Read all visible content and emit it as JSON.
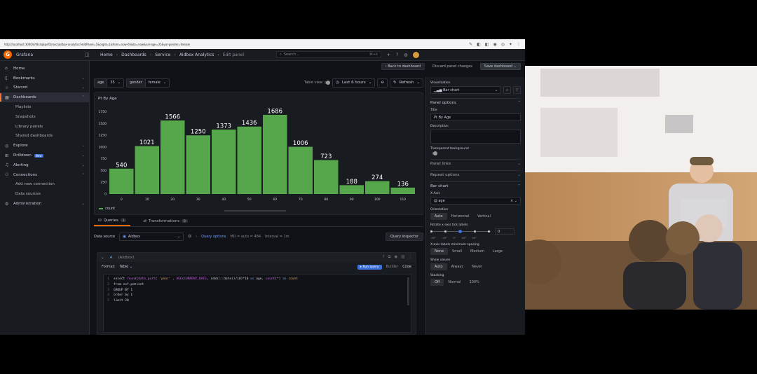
{
  "browser": {
    "url": "http://localhost:3000/d/fdx4qkqef1lmoc/aidbox-analytics?editPanel=1&orgId=1&from=now-6h&to=now&var-age=35&var-gender=female"
  },
  "app": {
    "name": "Grafana",
    "logo_letter": "G",
    "breadcrumbs": [
      "Home",
      "Dashboards",
      "Service",
      "Aidbox Analytics",
      "Edit panel"
    ],
    "search_placeholder": "Search...",
    "search_shortcut": "⌘+k",
    "plus": "+",
    "colors": {
      "brand": "#f46800",
      "bar": "#56a64b",
      "accent": "#3d71d9"
    }
  },
  "sidebar": {
    "items": [
      {
        "label": "Home",
        "icon": "home-icon"
      },
      {
        "label": "Bookmarks",
        "icon": "bookmark-icon"
      },
      {
        "label": "Starred",
        "icon": "star-icon"
      },
      {
        "label": "Dashboards",
        "icon": "dashboards-icon",
        "active": true
      },
      {
        "label": "Playlists",
        "sub": true
      },
      {
        "label": "Snapshots",
        "sub": true
      },
      {
        "label": "Library panels",
        "sub": true
      },
      {
        "label": "Shared dashboards",
        "sub": true
      },
      {
        "label": "Explore",
        "icon": "compass-icon"
      },
      {
        "label": "Drilldown",
        "icon": "drilldown-icon",
        "badge": "New"
      },
      {
        "label": "Alerting",
        "icon": "bell-icon"
      },
      {
        "label": "Connections",
        "icon": "plug-icon"
      },
      {
        "label": "Add new connection",
        "sub": true
      },
      {
        "label": "Data sources",
        "sub": true
      },
      {
        "label": "Administration",
        "icon": "gear-icon"
      }
    ]
  },
  "toolbar": {
    "back": "Back to dashboard",
    "discard": "Discard panel changes",
    "save": "Save dashboard"
  },
  "vars": {
    "age_label": "age",
    "age_value": "35",
    "gender_label": "gender",
    "gender_value": "female",
    "table_view": "Table view",
    "time_range": "Last 6 hours",
    "refresh": "Refresh"
  },
  "panel": {
    "title": "Pt By Age",
    "legend": "count"
  },
  "chart_data": {
    "type": "bar",
    "categories": [
      "0",
      "10",
      "20",
      "30",
      "40",
      "50",
      "60",
      "70",
      "80",
      "90",
      "100",
      "110"
    ],
    "values": [
      540,
      1021,
      1566,
      1250,
      1373,
      1436,
      1686,
      1006,
      723,
      188,
      274,
      136
    ],
    "yticks": [
      0,
      250,
      500,
      750,
      1000,
      1250,
      1500,
      1750
    ],
    "ylim": [
      0,
      1850
    ],
    "series": [
      {
        "name": "count",
        "values": [
          540,
          1021,
          1566,
          1250,
          1373,
          1436,
          1686,
          1006,
          723,
          188,
          274,
          136
        ]
      }
    ],
    "legend_position": "bottom-left",
    "grid": false
  },
  "queries": {
    "tab_queries": "Queries",
    "tab_queries_count": "1",
    "tab_transforms": "Transformations",
    "tab_transforms_count": "0",
    "ds_label": "Data source",
    "ds_value": "Aidbox",
    "query_options": "Query options",
    "query_meta": "MD = auto = 484",
    "interval": "Interval = 1m",
    "inspector": "Query inspector",
    "row_letter": "A",
    "row_source": "(Aidbox)",
    "format_label": "Format:",
    "format_value": "Table",
    "run": "Run query",
    "builder": "Builder",
    "code": "Code",
    "lines": [
      {
        "no": "1",
        "html": "select <span class=\"fn\">round</span>(<span class=\"fn\">date_part</span>( <span class=\"str\">'year'</span> , <span class=\"fn\">AGE</span>(<span class=\"fn\">CURRENT_DATE</span>, (dob)::date))/10)*10 <span class=\"kw\">as</span> age, <span class=\"fn\">count</span>(*) <span class=\"kw\">as</span> <span class=\"str\">count</span>"
      },
      {
        "no": "2",
        "html": "from sof.patient"
      },
      {
        "no": "3",
        "html": "GROUP BY 1"
      },
      {
        "no": "4",
        "html": "order by 1"
      },
      {
        "no": "5",
        "html": "limit 20"
      }
    ]
  },
  "options": {
    "viz_label": "Visualization",
    "viz_value": "Bar chart",
    "panel_options": "Panel options",
    "title_label": "Title",
    "title_value": "Pt By Age",
    "desc_label": "Description",
    "transparent": "Transparent background",
    "panel_links": "Panel links",
    "repeat": "Repeat options",
    "bar_chart": "Bar chart",
    "xaxis_label": "X Axis",
    "xaxis_value": "age",
    "orientation_label": "Orientation",
    "orientations": [
      "Auto",
      "Horizontal",
      "Vertical"
    ],
    "rotate_label": "Rotate x-axis tick labels",
    "rotate_value": "0",
    "rotate_ticks": [
      "-90°",
      "-45°",
      "0°",
      "45°",
      "90°"
    ],
    "spacing_label": "X-axis labels minimum spacing",
    "spacing": [
      "None",
      "Small",
      "Medium",
      "Large"
    ],
    "show_values_label": "Show values",
    "show_values": [
      "Auto",
      "Always",
      "Never"
    ],
    "stacking_label": "Stacking",
    "stacking": [
      "Off",
      "Normal",
      "100%"
    ]
  }
}
